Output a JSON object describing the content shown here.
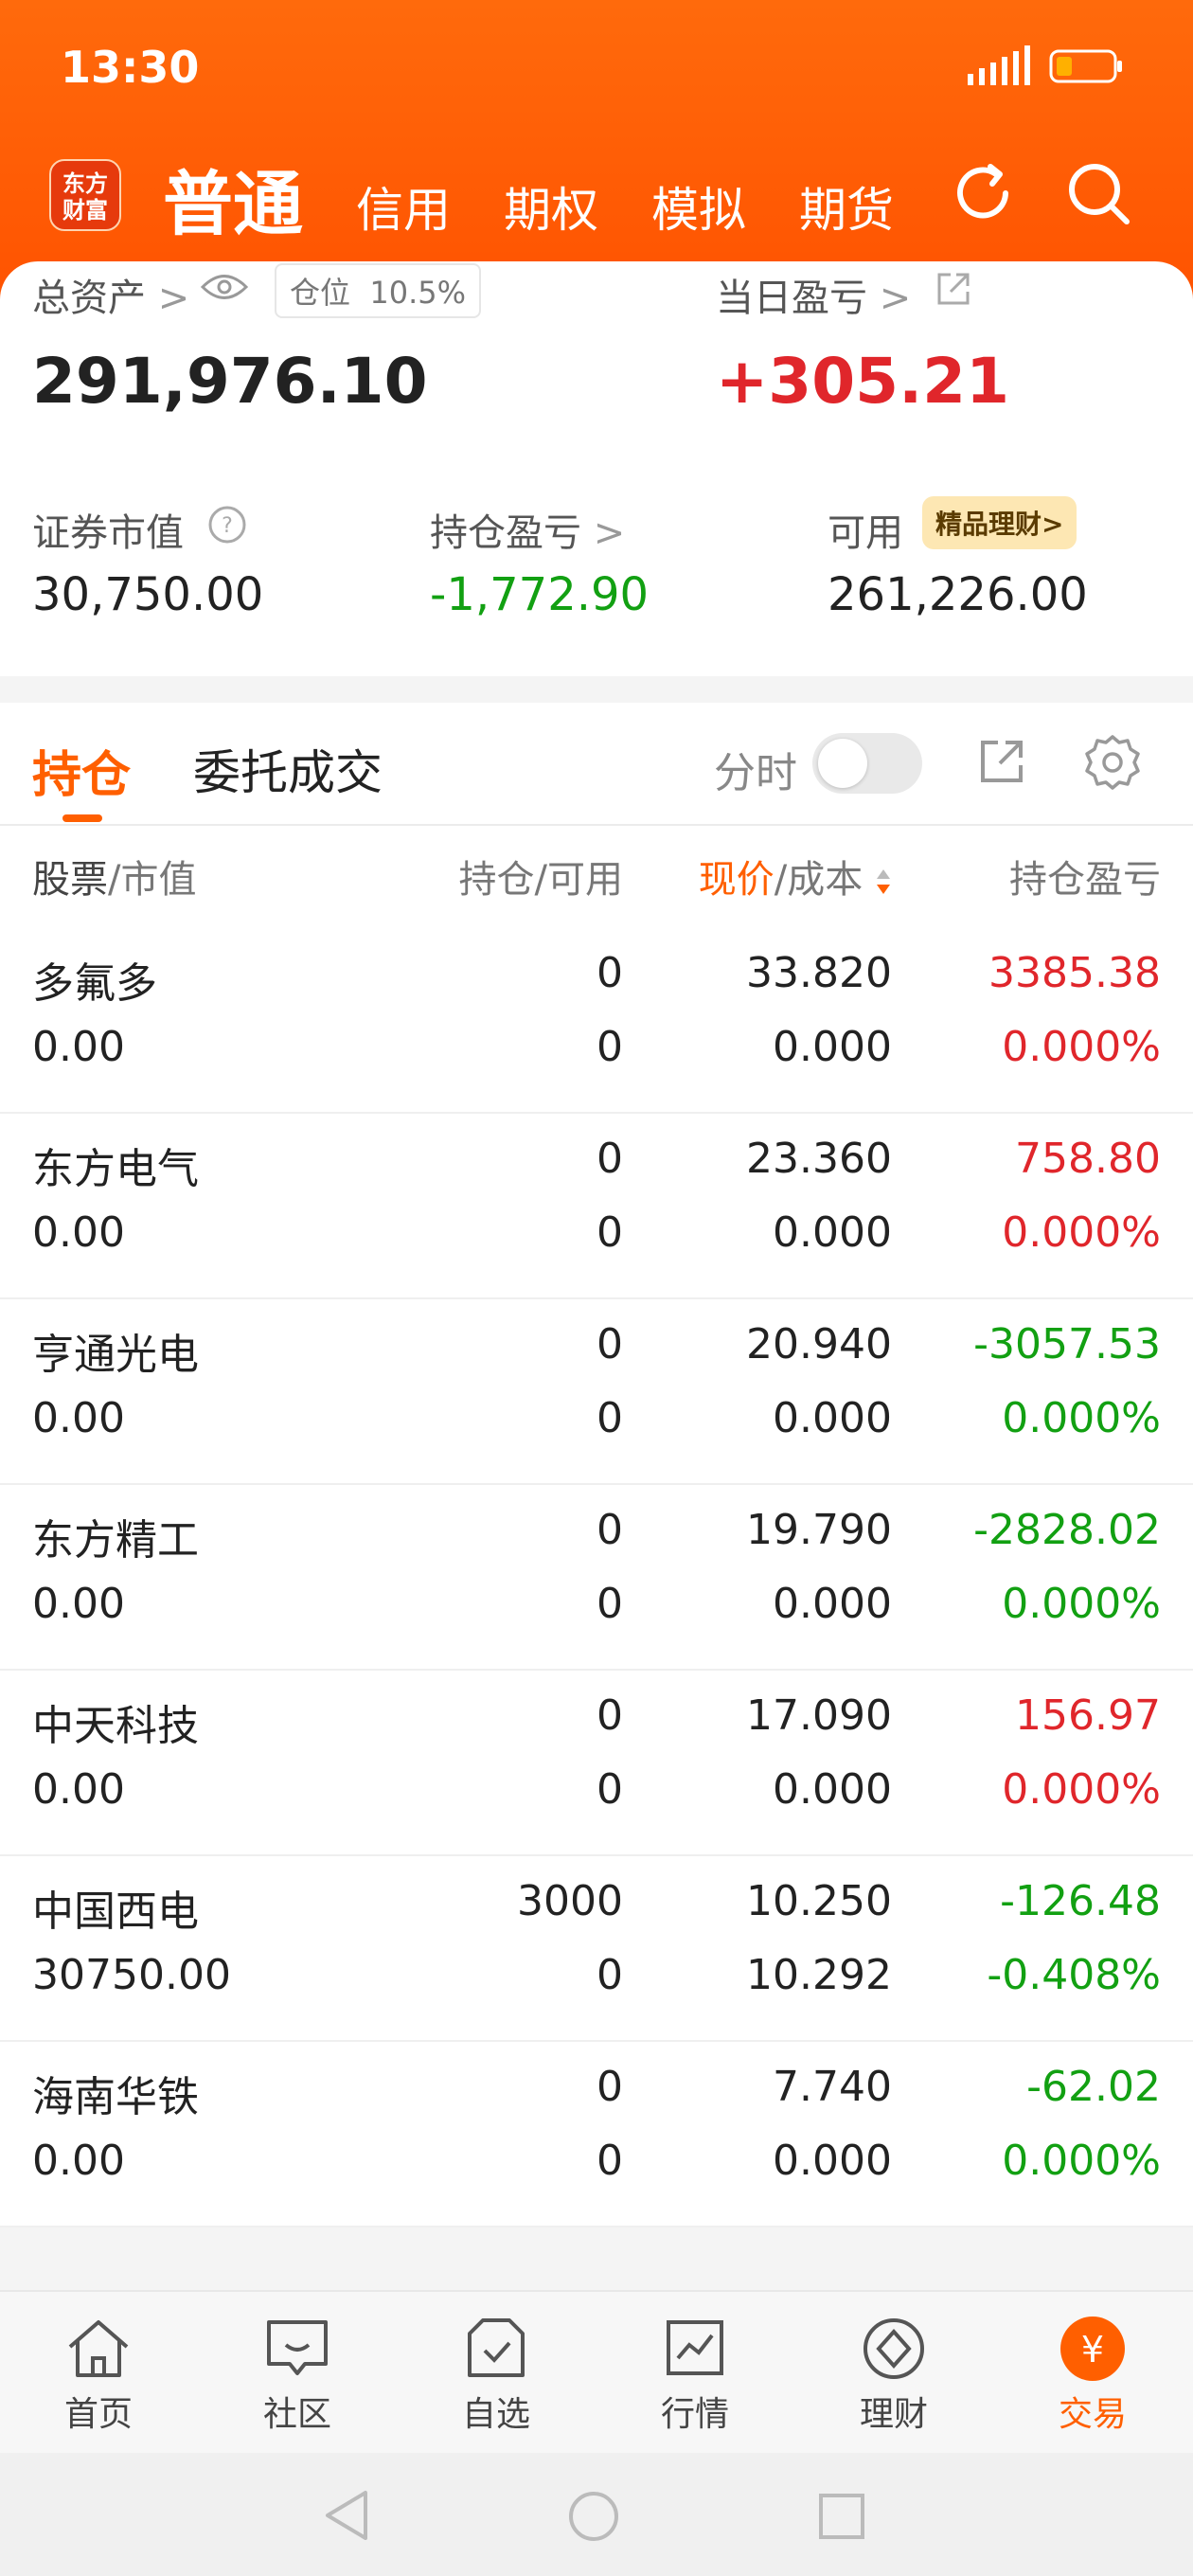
{
  "status": {
    "time": "13:30"
  },
  "header": {
    "logo_line1": "东方",
    "logo_line2": "财富",
    "tabs": [
      {
        "label": "普通",
        "active": true
      },
      {
        "label": "信用"
      },
      {
        "label": "期权"
      },
      {
        "label": "模拟"
      },
      {
        "label": "期货"
      }
    ],
    "refresh_icon": "refresh-icon",
    "search_icon": "search-icon"
  },
  "summary": {
    "total_assets_label": "总资产",
    "position_pill_label": "仓位",
    "position_pill_value": "10.5%",
    "total_assets_value": "291,976.10",
    "daily_pnl_label": "当日盈亏",
    "daily_pnl_value": "+305.21",
    "market_value_label": "证券市值",
    "market_value": "30,750.00",
    "hold_pnl_label": "持仓盈亏",
    "hold_pnl_value": "-1,772.90",
    "available_label": "可用",
    "available_badge": "精品理财>",
    "available_value": "261,226.00"
  },
  "holdings_tabs": {
    "active": "持仓",
    "second": "委托成交",
    "toggle_label": "分时"
  },
  "columns": {
    "stock": "股票",
    "market_value": "/市值",
    "hold_avail": "持仓/可用",
    "price_hl": "现价",
    "cost": "/成本",
    "pnl": "持仓盈亏"
  },
  "rows": [
    {
      "name": "多氟多",
      "mv": "0.00",
      "hold": "0",
      "avail": "0",
      "price": "33.820",
      "cost": "0.000",
      "pnl": "3385.38",
      "pct": "0.000%",
      "pnl_color": "red",
      "pct_color": "red"
    },
    {
      "name": "东方电气",
      "mv": "0.00",
      "hold": "0",
      "avail": "0",
      "price": "23.360",
      "cost": "0.000",
      "pnl": "758.80",
      "pct": "0.000%",
      "pnl_color": "red",
      "pct_color": "red"
    },
    {
      "name": "亨通光电",
      "mv": "0.00",
      "hold": "0",
      "avail": "0",
      "price": "20.940",
      "cost": "0.000",
      "pnl": "-3057.53",
      "pct": "0.000%",
      "pnl_color": "green",
      "pct_color": "green"
    },
    {
      "name": "东方精工",
      "mv": "0.00",
      "hold": "0",
      "avail": "0",
      "price": "19.790",
      "cost": "0.000",
      "pnl": "-2828.02",
      "pct": "0.000%",
      "pnl_color": "green",
      "pct_color": "green"
    },
    {
      "name": "中天科技",
      "mv": "0.00",
      "hold": "0",
      "avail": "0",
      "price": "17.090",
      "cost": "0.000",
      "pnl": "156.97",
      "pct": "0.000%",
      "pnl_color": "red",
      "pct_color": "red"
    },
    {
      "name": "中国西电",
      "mv": "30750.00",
      "hold": "3000",
      "avail": "0",
      "price": "10.250",
      "cost": "10.292",
      "pnl": "-126.48",
      "pct": "-0.408%",
      "pnl_color": "green",
      "pct_color": "green"
    },
    {
      "name": "海南华铁",
      "mv": "0.00",
      "hold": "0",
      "avail": "0",
      "price": "7.740",
      "cost": "0.000",
      "pnl": "-62.02",
      "pct": "0.000%",
      "pnl_color": "green",
      "pct_color": "green"
    }
  ],
  "bottom_nav": [
    {
      "label": "首页",
      "icon": "home-icon"
    },
    {
      "label": "社区",
      "icon": "chat-icon"
    },
    {
      "label": "自选",
      "icon": "watchlist-icon"
    },
    {
      "label": "行情",
      "icon": "market-chart-icon"
    },
    {
      "label": "理财",
      "icon": "wealth-icon"
    },
    {
      "label": "交易",
      "icon": "trade-icon",
      "active": true
    }
  ],
  "colors": {
    "brand_orange": "#ff5f00",
    "up_red": "#e0262b",
    "down_green": "#12a012"
  }
}
